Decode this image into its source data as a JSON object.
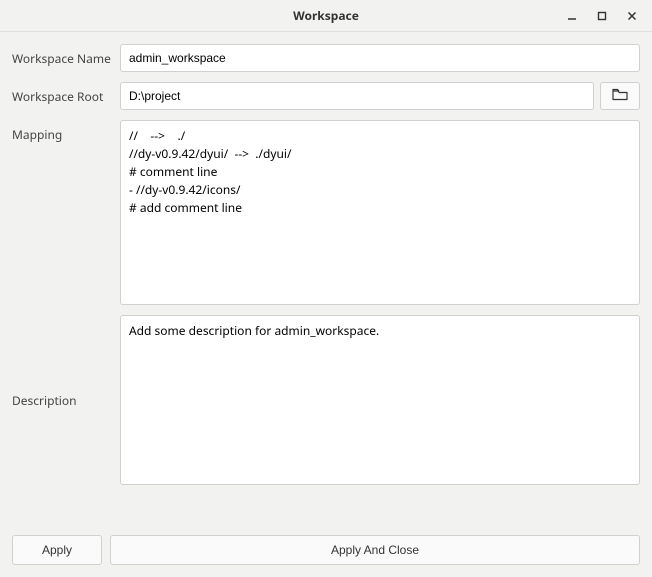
{
  "window": {
    "title": "Workspace"
  },
  "form": {
    "nameLabel": "Workspace Name",
    "nameValue": "admin_workspace",
    "rootLabel": "Workspace Root",
    "rootValue": "D:\\project",
    "mappingLabel": "Mapping",
    "mappingValue": "//    -->    ./\n//dy-v0.9.42/dyui/  -->  ./dyui/\n# comment line\n- //dy-v0.9.42/icons/\n# add comment line",
    "descriptionLabel": "Description",
    "descriptionValue": "Add some description for admin_workspace."
  },
  "buttons": {
    "apply": "Apply",
    "applyAndClose": "Apply And Close"
  }
}
